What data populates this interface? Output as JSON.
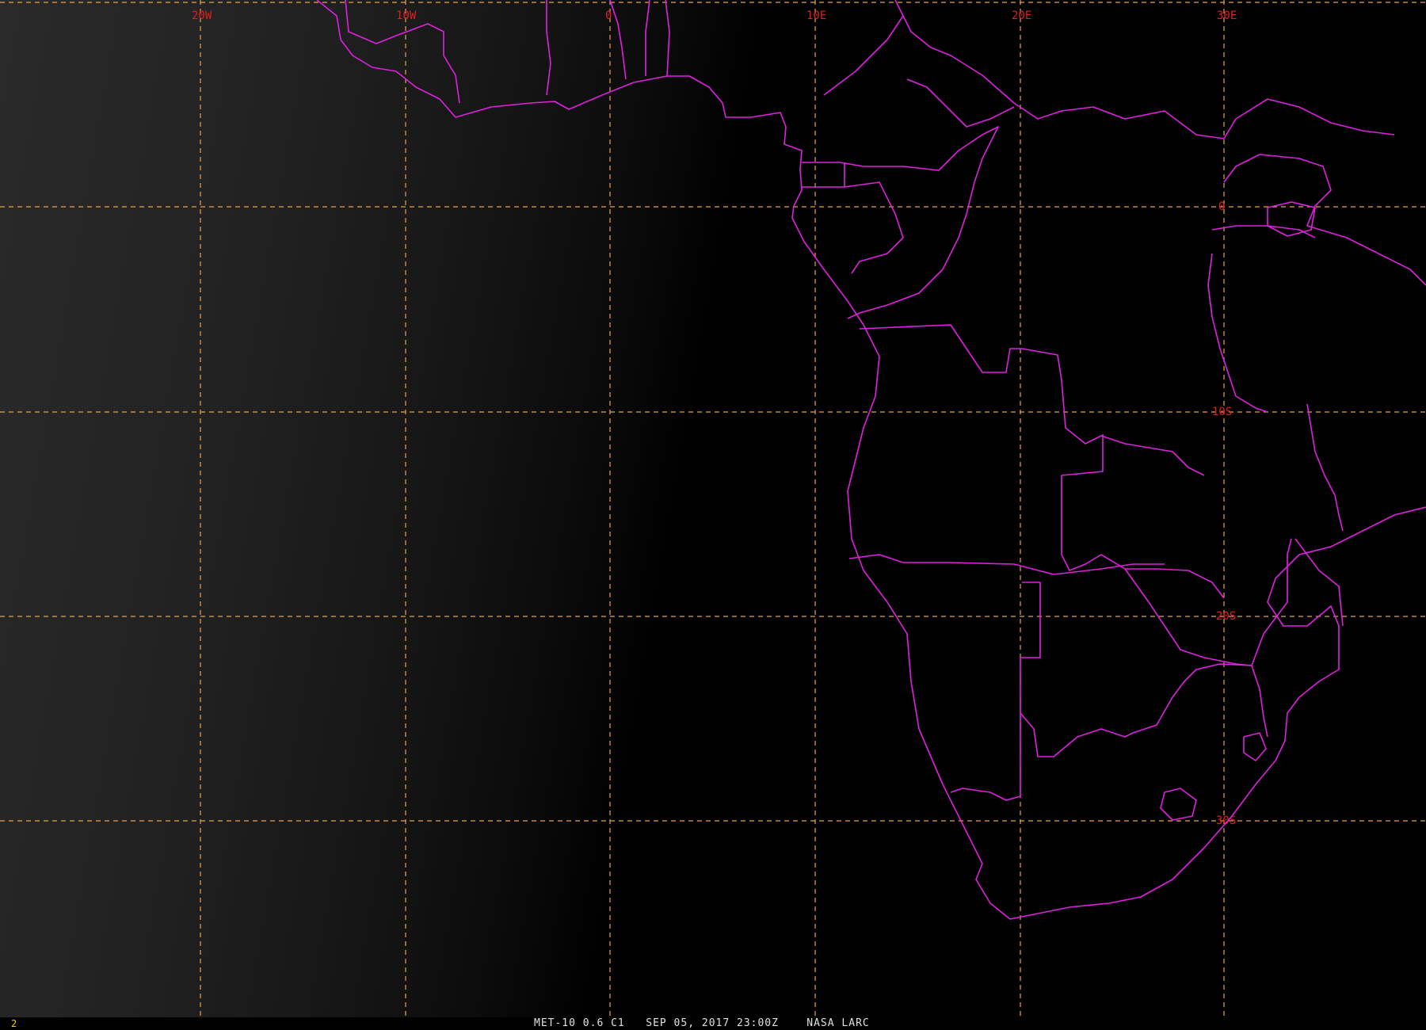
{
  "graticule": {
    "longitude_labels": [
      "20W",
      "10W",
      "0",
      "10E",
      "20E",
      "30E"
    ],
    "latitude_labels": [
      "0",
      "10S",
      "20S",
      "30S"
    ]
  },
  "status_bar": {
    "frame_number": "2",
    "satellite": "MET-10",
    "channel": "0.6 C1",
    "datetime": "SEP 05, 2017 23:00Z",
    "source": "NASA LARC"
  },
  "colors": {
    "borders": "#e020e0",
    "grid": "#e8a24a",
    "grid_labels": "#e02020",
    "frame_number": "#f2d000"
  }
}
